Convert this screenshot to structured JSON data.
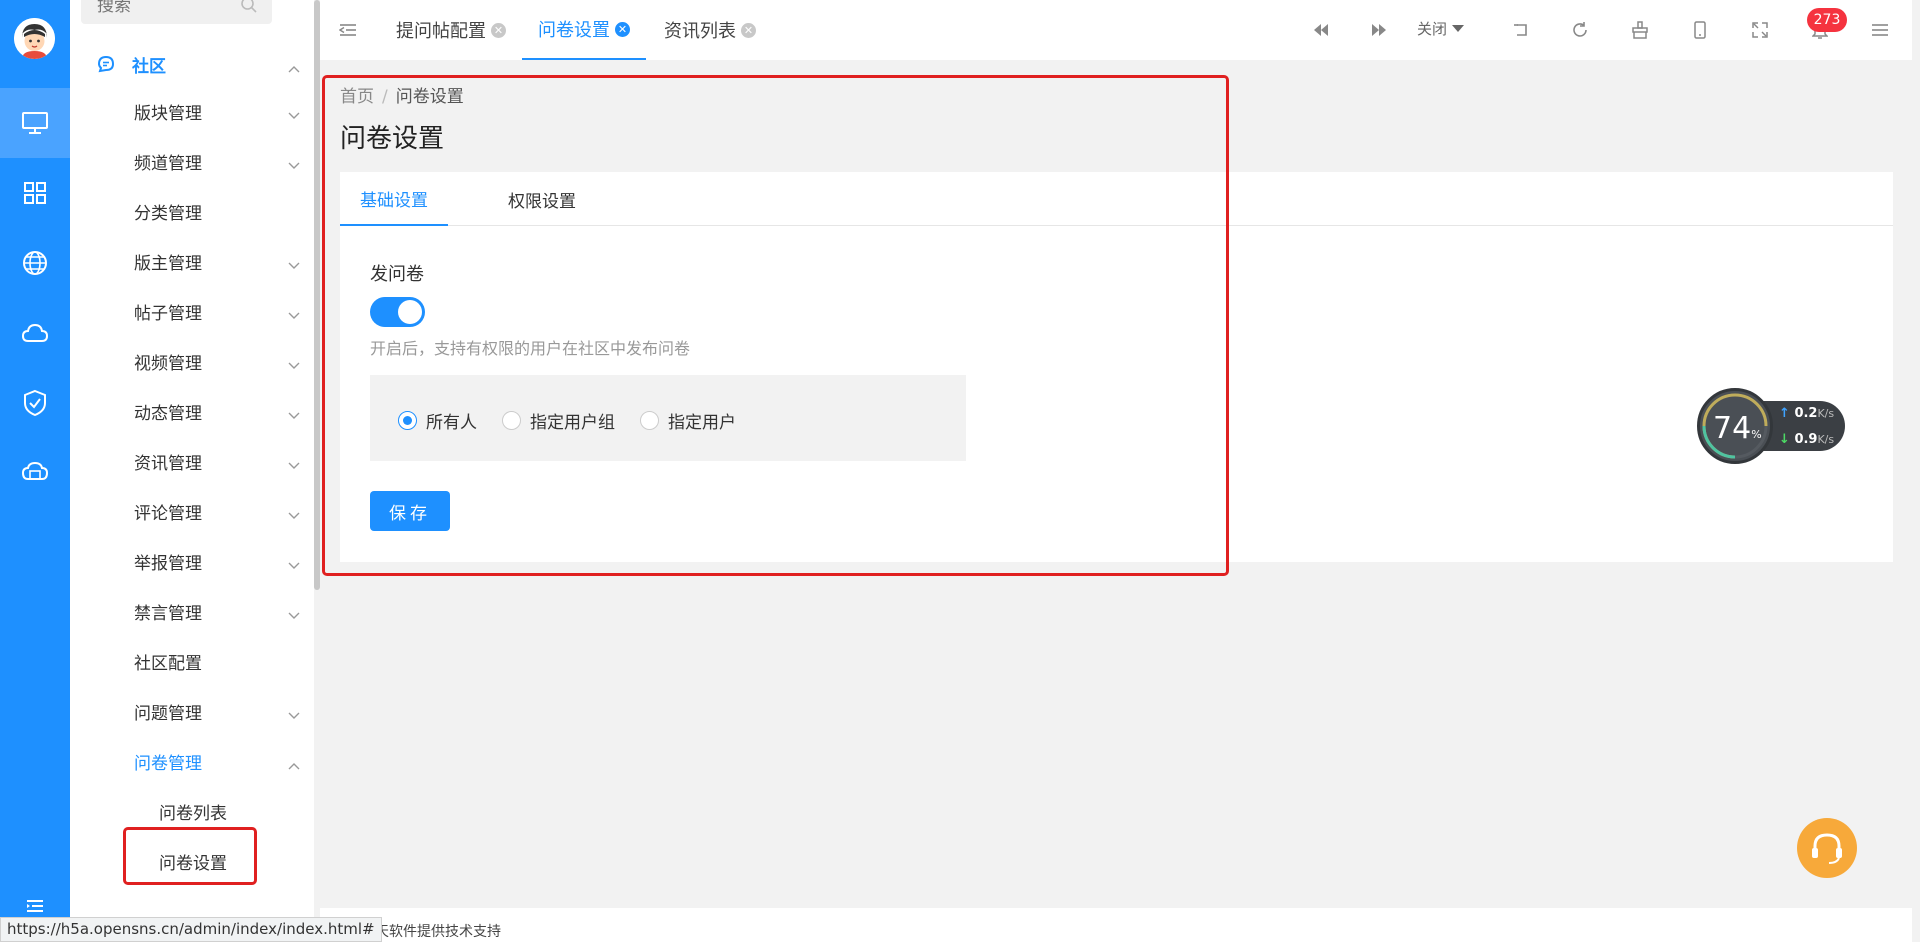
{
  "sidebar": {
    "search_placeholder": "搜索",
    "group_label": "社区",
    "items": [
      {
        "label": "版块管理"
      },
      {
        "label": "频道管理"
      },
      {
        "label": "分类管理"
      },
      {
        "label": "版主管理"
      },
      {
        "label": "帖子管理"
      },
      {
        "label": "视频管理"
      },
      {
        "label": "动态管理"
      },
      {
        "label": "资讯管理"
      },
      {
        "label": "评论管理"
      },
      {
        "label": "举报管理"
      },
      {
        "label": "禁言管理"
      },
      {
        "label": "社区配置"
      },
      {
        "label": "问题管理"
      },
      {
        "label": "问卷管理"
      }
    ],
    "sub_items": [
      {
        "label": "问卷列表"
      },
      {
        "label": "问卷设置"
      }
    ]
  },
  "topbar": {
    "tabs": [
      {
        "label": "提问帖配置"
      },
      {
        "label": "问卷设置"
      },
      {
        "label": "资讯列表"
      }
    ],
    "close_label": "关闭",
    "notification_count": "273"
  },
  "main": {
    "breadcrumb": {
      "home": "首页",
      "separator": "/",
      "current": "问卷设置"
    },
    "title": "问卷设置",
    "tabs": [
      {
        "label": "基础设置"
      },
      {
        "label": "权限设置"
      }
    ],
    "field_label": "发问卷",
    "toggle_on": true,
    "hint": "开启后，支持有权限的用户在社区中发布问卷",
    "radio_options": [
      {
        "label": "所有人",
        "checked": true
      },
      {
        "label": "指定用户组",
        "checked": false
      },
      {
        "label": "指定用户",
        "checked": false
      }
    ],
    "save_label": "保存"
  },
  "speed_widget": {
    "percent": "74",
    "percent_unit": "%",
    "up": "0.2",
    "down": "0.9",
    "unit": "K/s"
  },
  "footer": {
    "text": "由想天软件提供技术支持"
  },
  "status_url": "https://h5a.opensns.cn/admin/index/index.html#",
  "colors": {
    "primary": "#1e90ff",
    "highlight": "#e02020",
    "badge": "#f5333f",
    "help": "#f7a93a"
  }
}
